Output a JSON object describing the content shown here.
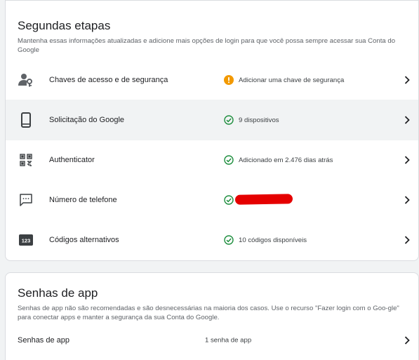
{
  "segundas": {
    "title": "Segundas etapas",
    "description": "Mantenha essas informações atualizadas e adicione mais opções de login para que você possa sempre acessar sua Conta do Google",
    "items": [
      {
        "icon": "person-key-icon",
        "label": "Chaves de acesso e de segurança",
        "status_icon": "warning-icon",
        "status": "Adicionar uma chave de segurança"
      },
      {
        "icon": "phone-icon",
        "label": "Solicitação do Google",
        "status_icon": "check-circle-icon",
        "status": "9 dispositivos"
      },
      {
        "icon": "qr-code-icon",
        "label": "Authenticator",
        "status_icon": "check-circle-icon",
        "status": "Adicionado em 2.476 dias atrás"
      },
      {
        "icon": "sms-icon",
        "label": "Número de telefone",
        "status_icon": "check-circle-icon",
        "status": ""
      },
      {
        "icon": "backup-codes-icon",
        "label": "Códigos alternativos",
        "status_icon": "check-circle-icon",
        "status": "10 códigos disponíveis"
      }
    ]
  },
  "app_passwords": {
    "title": "Senhas de app",
    "description": "Senhas de app não são recomendadas e são desnecessárias na maioria dos casos. Use o recurso \"Fazer login com o Goo-gle\" para conectar apps e manter a segurança da sua Conta do Google.",
    "row_label": "Senhas de app",
    "row_status": "1 senha de app"
  },
  "colors": {
    "warning": "#f29900",
    "success": "#1e8e3e",
    "redaction": "#e50000"
  }
}
